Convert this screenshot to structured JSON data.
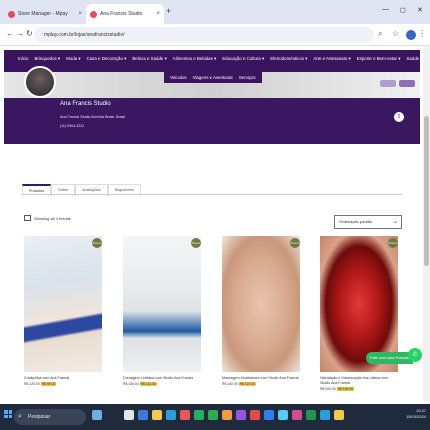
{
  "browser": {
    "tabs": [
      {
        "title": "Store Manager - Mpay",
        "active": false
      },
      {
        "title": "Ana Francis Studio",
        "active": true
      }
    ],
    "url": "mplay.com.br/lojas/anafrancisstudio/"
  },
  "store": {
    "nav_items": [
      "Início",
      "Brinquedos",
      "Moda",
      "Casa e Decoração",
      "Beleza e Saúde",
      "Alimentos e Bebidas",
      "Educação e Cultura",
      "Eletrodomésticos",
      "Arte e Artesanato",
      "Esporte e Bem-estar",
      "Saúde",
      "Veículos",
      "Viagens e Aventuras",
      "Serviços"
    ],
    "name": "Ana Francis Studio",
    "address": "Ana Francis Studio Avenida Brasil, Brasil",
    "phone": "(11) 9404-2222"
  },
  "tabs": [
    "Produtos",
    "Sobre",
    "Avaliações",
    "Seguidores"
  ],
  "filter_label": "Showing all 4 results",
  "sort_label": "Ordenação padrão",
  "products": [
    {
      "title": "Criolipólise com Ana Francis",
      "price": "R$ 120,00",
      "badge": "Promo",
      "price_tag": "R$ 99,00"
    },
    {
      "title": "Drenagem Linfática com Studio Ana Francis",
      "price": "R$ 130,00",
      "badge": "Promo",
      "price_tag": "R$ 110,00"
    },
    {
      "title": "Massagem Modeladora com Studio Ana Francis",
      "price": "R$ 140,00",
      "badge": "Promo",
      "price_tag": "R$ 119,00"
    },
    {
      "title": "Hidratação e Volumização dos Lábios com Studio Ana Francis",
      "price": "R$ 200,00",
      "badge": "Promo",
      "price_tag": "R$ 169,00"
    }
  ],
  "whatsapp_label": "Fale com Ana Francis",
  "taskbar": {
    "search_placeholder": "Pesquisar",
    "time": "10:37",
    "date": "15/03/2024"
  }
}
